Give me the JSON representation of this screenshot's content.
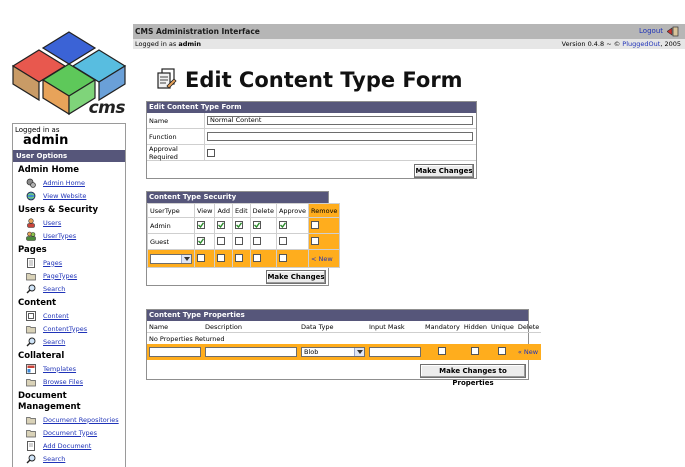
{
  "header": {
    "app_title": "CMS Administration Interface",
    "logout_label": "Logout",
    "logged_in_prefix": "Logged in as",
    "logged_in_user": "admin",
    "version_text": "Version 0.4.8 ~ ©",
    "version_link": "PluggedOut",
    "version_year": ", 2005"
  },
  "logo": {
    "text": "cms"
  },
  "sidebar": {
    "logged_in_label": "Logged in as",
    "user": "admin",
    "options_header": "User Options",
    "sections": [
      {
        "title": "Admin Home",
        "items": [
          {
            "label": "Admin Home",
            "icon": "gears-icon"
          },
          {
            "label": "View Website",
            "icon": "globe-icon"
          }
        ]
      },
      {
        "title": "Users & Security",
        "items": [
          {
            "label": "Users",
            "icon": "user-icon"
          },
          {
            "label": "UserTypes",
            "icon": "users-icon"
          }
        ]
      },
      {
        "title": "Pages",
        "items": [
          {
            "label": "Pages",
            "icon": "page-icon"
          },
          {
            "label": "PageTypes",
            "icon": "folder-icon"
          },
          {
            "label": "Search",
            "icon": "search-icon"
          }
        ]
      },
      {
        "title": "Content",
        "items": [
          {
            "label": "Content",
            "icon": "content-icon"
          },
          {
            "label": "ContentTypes",
            "icon": "folder-icon"
          },
          {
            "label": "Search",
            "icon": "search-icon"
          }
        ]
      },
      {
        "title": "Collateral",
        "items": [
          {
            "label": "Templates",
            "icon": "template-icon"
          },
          {
            "label": "Browse Files",
            "icon": "folder-icon"
          }
        ]
      },
      {
        "title": "Document Management",
        "items": [
          {
            "label": "Document Repositories",
            "icon": "folder-icon"
          },
          {
            "label": "Document Types",
            "icon": "folder-icon"
          },
          {
            "label": "Add Document",
            "icon": "page-icon"
          },
          {
            "label": "Search",
            "icon": "search-icon"
          }
        ]
      }
    ]
  },
  "page": {
    "title": "Edit Content Type Form"
  },
  "form_panel": {
    "header": "Edit Content Type Form",
    "name_label": "Name",
    "name_value": "Normal Content",
    "function_label": "Function",
    "function_value": "",
    "approval_label": "Approval Required",
    "button": "Make Changes"
  },
  "security_panel": {
    "header": "Content Type Security",
    "columns": [
      "UserType",
      "View",
      "Add",
      "Edit",
      "Delete",
      "Approve",
      "Remove"
    ],
    "rows": [
      {
        "usertype": "Admin",
        "view": true,
        "add": true,
        "edit": true,
        "delete": true,
        "approve": true
      },
      {
        "usertype": "Guest",
        "view": true,
        "add": false,
        "edit": false,
        "delete": false,
        "approve": false
      }
    ],
    "new_label": "< New",
    "button": "Make Changes"
  },
  "properties_panel": {
    "header": "Content Type Properties",
    "columns": [
      "Name",
      "Description",
      "Data Type",
      "Input Mask",
      "Mandatory",
      "Hidden",
      "Unique",
      "Delete"
    ],
    "empty_message": "No Properties Returned",
    "datatype_selected": "Blob",
    "new_label": "« New",
    "button": "Make Changes to Properties"
  },
  "colors": {
    "accent_orange": "#ffad1d",
    "header_purple": "#56567a",
    "topbar_gray": "#b6b6b6",
    "link_blue": "#1f33b8"
  }
}
